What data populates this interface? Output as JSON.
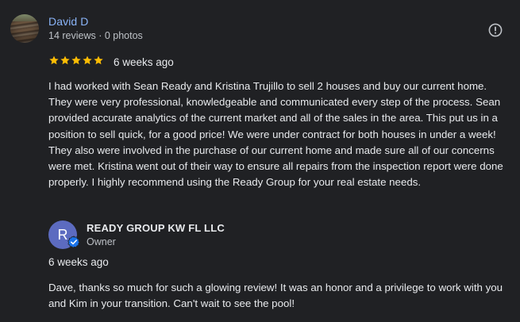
{
  "review": {
    "reviewer_name": "David D",
    "reviewer_meta": "14 reviews · 0 photos",
    "rating": 5,
    "rating_max": 5,
    "date": "6 weeks ago",
    "text": "I had worked with Sean Ready and Kristina Trujillo to sell 2 houses and buy our current home. They were very professional, knowledgeable and communicated every step of the process. Sean provided accurate analytics of the current market and all of the sales in the area. This put us in a position to sell quick, for a good price! We were under contract for both houses in under a week! They also were involved in the purchase of our current home and made sure all of our concerns were met. Kristina went out of their way to ensure all repairs from the inspection report were done properly. I highly recommend using the Ready Group for your real estate needs."
  },
  "owner_response": {
    "avatar_letter": "R",
    "owner_name": "READY GROUP KW FL LLC",
    "owner_role": "Owner",
    "date": "6 weeks ago",
    "text": "Dave, thanks so much for such a glowing review! It was an honor and a privilege to work with you and Kim in your transition. Can't wait to see the pool!"
  },
  "colors": {
    "background": "#202124",
    "link": "#8ab4f8",
    "star": "#fbbc04",
    "owner_avatar": "#5c6bc0",
    "verified_badge": "#1a73e8"
  },
  "icons": {
    "more": "report-flag-icon",
    "star": "star-icon",
    "verified": "verified-check-icon"
  }
}
